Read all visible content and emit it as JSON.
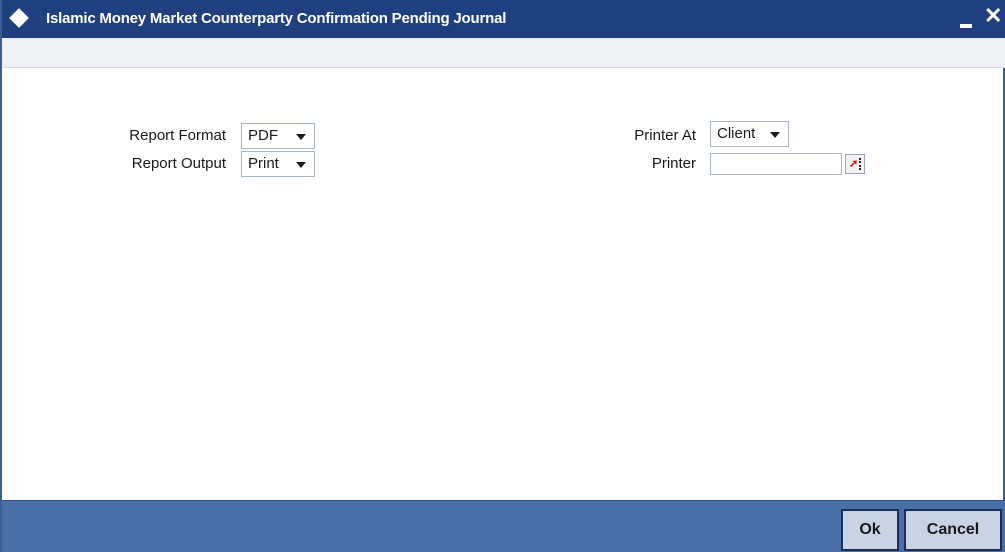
{
  "window": {
    "title": "Islamic Money Market Counterparty Confirmation Pending Journal",
    "minimize_glyph": "_",
    "close_glyph": "✕"
  },
  "form": {
    "report_format": {
      "label": "Report Format",
      "value": "PDF"
    },
    "report_output": {
      "label": "Report Output",
      "value": "Print"
    },
    "printer_at": {
      "label": "Printer At",
      "value": "Client"
    },
    "printer": {
      "label": "Printer",
      "value": ""
    }
  },
  "footer": {
    "ok_label": "Ok",
    "cancel_label": "Cancel"
  },
  "colors": {
    "titlebar": "#1f3f7f",
    "footer": "#4a6ea8",
    "button": "#c8d3e6"
  },
  "icons": [
    "diamond-icon",
    "minimize-icon",
    "close-icon",
    "chevron-down-icon",
    "list-of-values-icon"
  ]
}
